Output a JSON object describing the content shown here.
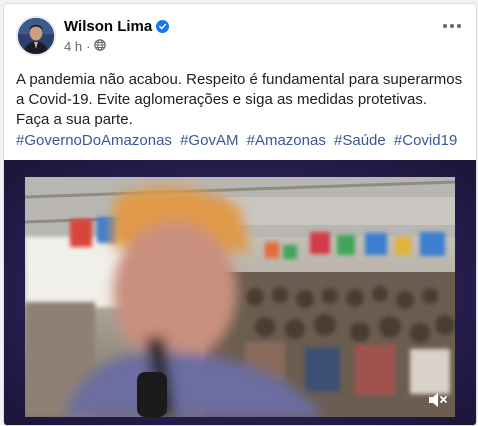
{
  "post": {
    "author": "Wilson Lima",
    "timestamp": "4 h",
    "separator": "·",
    "text": "A pandemia não acabou. Respeito é fundamental para superarmos a Covid-19. Evite aglomerações e siga as medidas protetivas. Faça a sua parte.",
    "hashtags": [
      "#GovernoDoAmazonas",
      "#GovAM",
      "#Amazonas",
      "#Saúde",
      "#Covid19"
    ]
  },
  "colors": {
    "link": "#385898",
    "verified": "#1877f2",
    "video_frame": "#241c4a"
  },
  "icons": {
    "verified": "verified-badge-icon",
    "privacy": "globe-icon",
    "more": "more-options-icon",
    "volume": "mute-icon"
  }
}
